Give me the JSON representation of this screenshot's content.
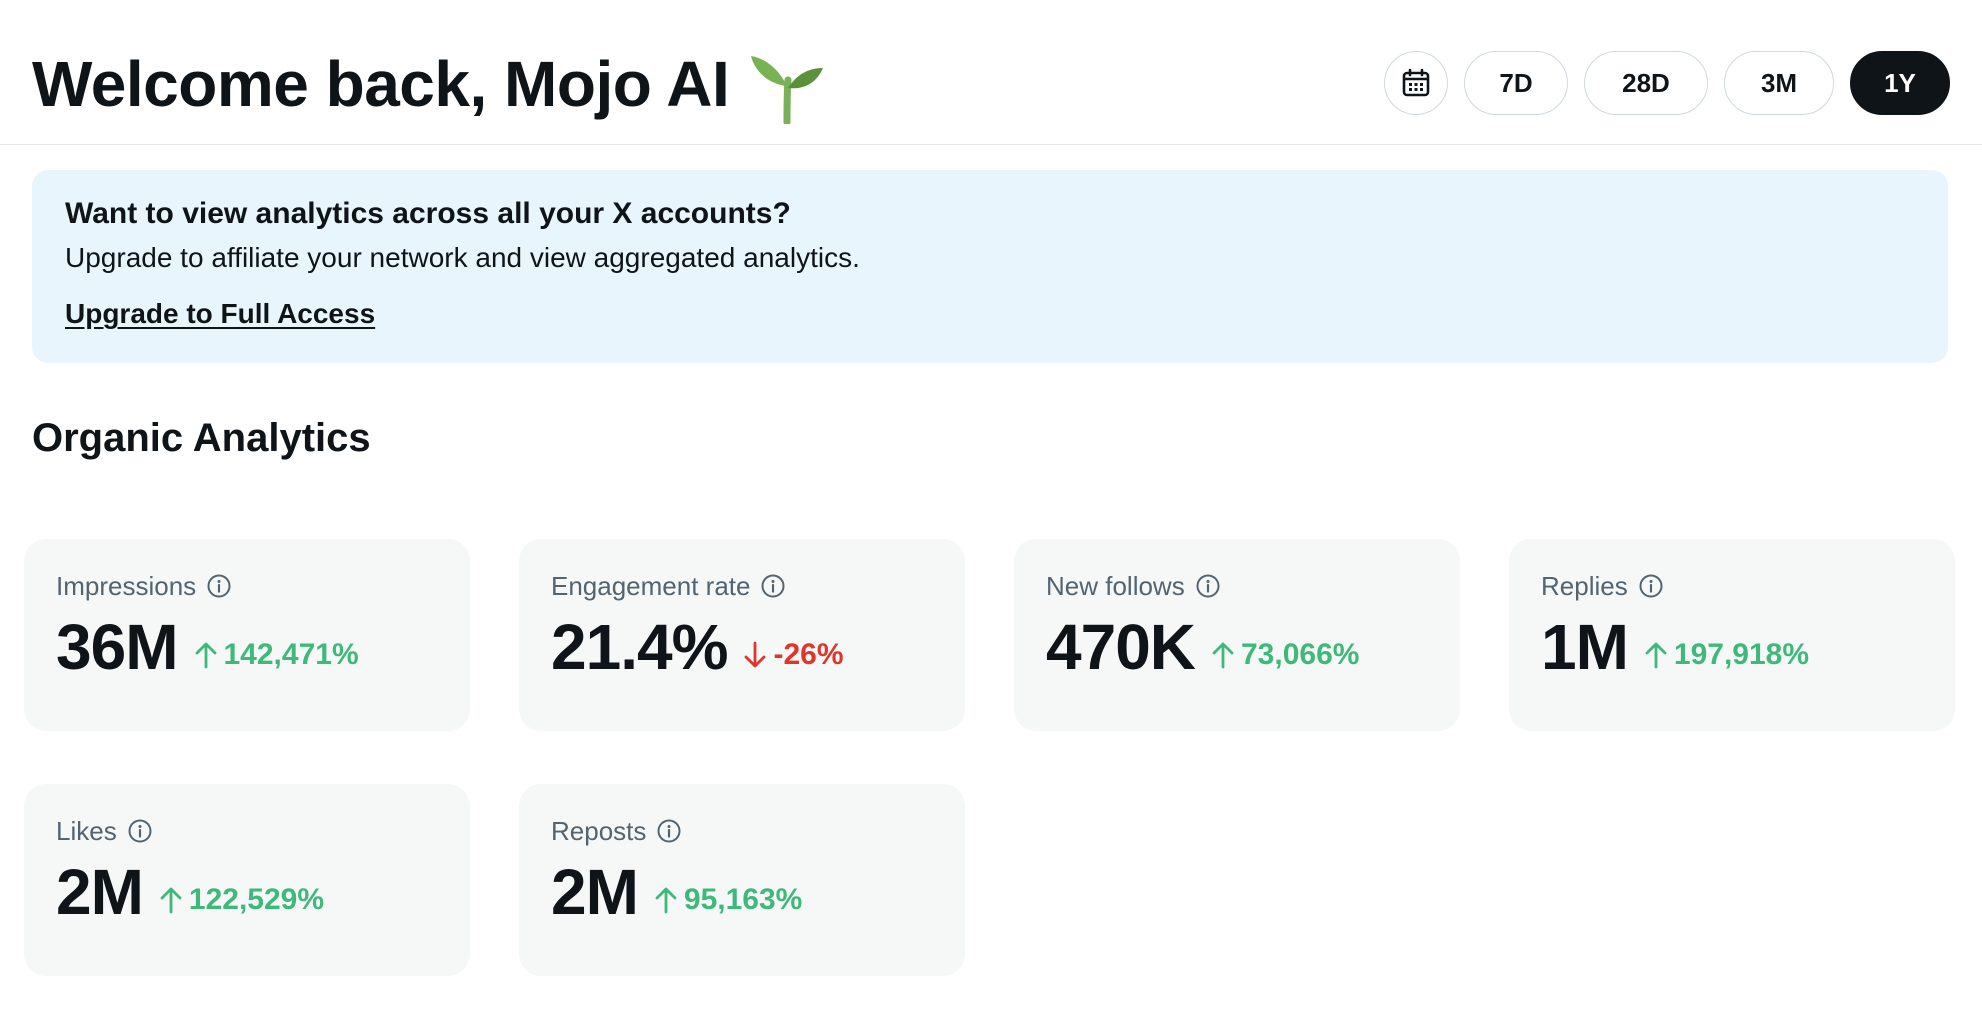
{
  "header": {
    "welcome_title": "Welcome back, Mojo AI",
    "emoji_icon": "seedling-icon",
    "calendar_icon": "calendar-icon",
    "ranges": [
      {
        "label": "7D",
        "active": false
      },
      {
        "label": "28D",
        "active": false
      },
      {
        "label": "3M",
        "active": false
      },
      {
        "label": "1Y",
        "active": true
      }
    ]
  },
  "banner": {
    "title": "Want to view analytics across all your X accounts?",
    "text": "Upgrade to affiliate your network and view aggregated analytics.",
    "link": "Upgrade to Full Access"
  },
  "section": {
    "title": "Organic Analytics"
  },
  "stats": [
    {
      "label": "Impressions",
      "value": "36M",
      "delta": "142,471%",
      "direction": "up"
    },
    {
      "label": "Engagement rate",
      "value": "21.4%",
      "delta": "-26%",
      "direction": "down"
    },
    {
      "label": "New follows",
      "value": "470K",
      "delta": "73,066%",
      "direction": "up"
    },
    {
      "label": "Replies",
      "value": "1M",
      "delta": "197,918%",
      "direction": "up"
    },
    {
      "label": "Likes",
      "value": "2M",
      "delta": "122,529%",
      "direction": "up"
    },
    {
      "label": "Reposts",
      "value": "2M",
      "delta": "95,163%",
      "direction": "up"
    }
  ],
  "colors": {
    "up": "#3fb97b",
    "down": "#e0352b",
    "banner_bg": "#e9f5fd",
    "card_bg": "#f6f8f8",
    "active_range_bg": "#0f1419"
  }
}
